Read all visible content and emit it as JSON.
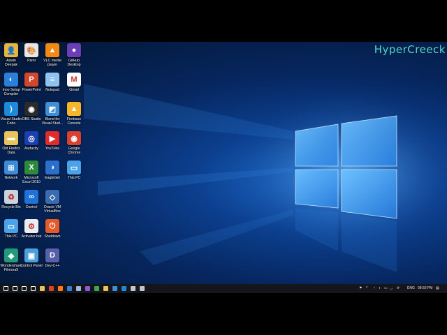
{
  "watermark": "HyperCreeck",
  "desktop_icons": [
    {
      "label": "Aswin\nDeepak",
      "name": "user-folder-icon",
      "color": "#e8b73a",
      "glyph": "👤"
    },
    {
      "label": "Paint",
      "name": "paint-icon",
      "color": "#e7e7e7",
      "glyph": "🎨"
    },
    {
      "label": "VLC media\nplayer",
      "name": "vlc-icon",
      "color": "#f08a14",
      "glyph": "▲"
    },
    {
      "label": "GitHub\nDesktop",
      "name": "github-icon",
      "color": "#6a3fb5",
      "glyph": "●"
    },
    {
      "label": "Inno Setup\nCompiler",
      "name": "inno-setup-icon",
      "color": "#2a7fd8",
      "glyph": "◐"
    },
    {
      "label": "PowerPoint",
      "name": "powerpoint-icon",
      "color": "#d2472b",
      "glyph": "P"
    },
    {
      "label": "Notepad",
      "name": "notepad-icon",
      "color": "#8ec3f0",
      "glyph": "≡"
    },
    {
      "label": "Gmail",
      "name": "gmail-icon",
      "color": "#ffffff",
      "glyph": "M"
    },
    {
      "label": "Visual Studio\nCode",
      "name": "vscode-icon",
      "color": "#1d8ad8",
      "glyph": "⟩"
    },
    {
      "label": "OBS Studio",
      "name": "obs-icon",
      "color": "#2b2b2b",
      "glyph": "◉"
    },
    {
      "label": "Blend for\nVisual Stud...",
      "name": "blend-icon",
      "color": "#3e8fd6",
      "glyph": "◩"
    },
    {
      "label": "Firebase\nConsole",
      "name": "firebase-icon",
      "color": "#f6b52a",
      "glyph": "▲"
    },
    {
      "label": "Old Firefox\nData",
      "name": "folder-icon",
      "color": "#e8c45a",
      "glyph": "▬"
    },
    {
      "label": "Audacity",
      "name": "audacity-icon",
      "color": "#1b3fae",
      "glyph": "◎"
    },
    {
      "label": "YouTube",
      "name": "youtube-icon",
      "color": "#e22b2b",
      "glyph": "▶"
    },
    {
      "label": "Google\nChrome",
      "name": "chrome-icon",
      "color": "#d9412f",
      "glyph": "◉"
    },
    {
      "label": "Network",
      "name": "network-icon",
      "color": "#3c8bd8",
      "glyph": "⊞"
    },
    {
      "label": "Microsoft\nExcel 2010",
      "name": "excel-icon",
      "color": "#2d8a3c",
      "glyph": "X"
    },
    {
      "label": "EagleGet",
      "name": "eagleget-icon",
      "color": "#2a6fc9",
      "glyph": "◑"
    },
    {
      "label": "This PC",
      "name": "this-pc-icon",
      "color": "#4aa3e8",
      "glyph": "▭"
    },
    {
      "label": "Recycle Bin",
      "name": "recycle-bin-icon",
      "color": "#c9d3dd",
      "glyph": "♻"
    },
    {
      "label": "Control",
      "name": "control-icon",
      "color": "#1e72d8",
      "glyph": "∞"
    },
    {
      "label": "Oracle VM\nVirtualBox",
      "name": "virtualbox-icon",
      "color": "#3a6ab0",
      "glyph": "◇"
    },
    {
      "label": "",
      "name": "blank-icon",
      "color": "transparent",
      "glyph": ""
    },
    {
      "label": "This PC",
      "name": "this-pc-2-icon",
      "color": "#4aa3e8",
      "glyph": "▭"
    },
    {
      "label": "Activator.bat",
      "name": "batch-file-icon",
      "color": "#e9eef3",
      "glyph": "⚙"
    },
    {
      "label": "Shutdown",
      "name": "shutdown-icon",
      "color": "#e45b2b",
      "glyph": "⏻"
    },
    {
      "label": "",
      "name": "blank-icon",
      "color": "transparent",
      "glyph": ""
    },
    {
      "label": "Wondershare\nFilmora9",
      "name": "filmora-icon",
      "color": "#1f9a7a",
      "glyph": "◆"
    },
    {
      "label": "Control Panel",
      "name": "control-panel-icon",
      "color": "#4b9fdb",
      "glyph": "▣"
    },
    {
      "label": "Dev-C++",
      "name": "devcpp-icon",
      "color": "#5560a8",
      "glyph": "D"
    }
  ],
  "taskbar": {
    "pinned": [
      {
        "name": "start-icon",
        "color": "#ffffff"
      },
      {
        "name": "search-icon",
        "color": "#ffffff"
      },
      {
        "name": "cortana-icon",
        "color": "#ffffff"
      },
      {
        "name": "task-view-icon",
        "color": "#ffffff"
      },
      {
        "name": "file-explorer-icon",
        "color": "#e8c45a"
      },
      {
        "name": "chrome-taskbar-icon",
        "color": "#d9412f"
      },
      {
        "name": "firefox-taskbar-icon",
        "color": "#ff7a1a"
      },
      {
        "name": "firefox-dev-taskbar-icon",
        "color": "#2f7ee0"
      },
      {
        "name": "settings-taskbar-icon",
        "color": "#9fb7d9"
      },
      {
        "name": "visual-studio-taskbar-icon",
        "color": "#8b5ad6"
      },
      {
        "name": "app-taskbar-icon",
        "color": "#3aa858"
      },
      {
        "name": "folder-taskbar-icon",
        "color": "#e8c45a"
      },
      {
        "name": "blend-taskbar-icon",
        "color": "#3e8fd6"
      },
      {
        "name": "vscode-taskbar-icon",
        "color": "#1d8ad8"
      },
      {
        "name": "mail-taskbar-icon",
        "color": "#bfc6d0"
      },
      {
        "name": "obs-taskbar-icon",
        "color": "#bfc6d0"
      }
    ],
    "language": "ENG",
    "time": "08:50 PM"
  }
}
